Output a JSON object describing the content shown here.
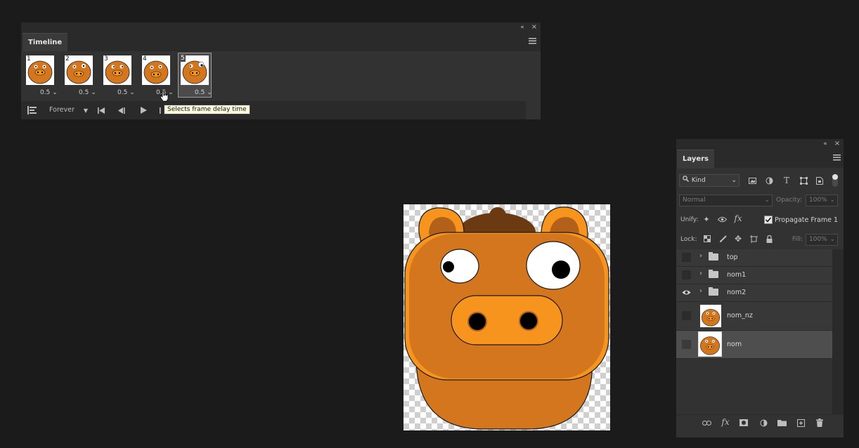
{
  "timeline": {
    "tab": "Timeline",
    "frames": [
      {
        "number": "1",
        "delay": "0.5"
      },
      {
        "number": "2",
        "delay": "0.5"
      },
      {
        "number": "3",
        "delay": "0.5"
      },
      {
        "number": "4",
        "delay": "0.5"
      },
      {
        "number": "5",
        "delay": "0.5"
      }
    ],
    "loop": "Forever",
    "tooltip": "Selects frame delay time"
  },
  "layers": {
    "tab": "Layers",
    "filter_kind": "Kind",
    "blend_mode": "Normal",
    "opacity_label": "Opacity:",
    "opacity_value": "100%",
    "unify_label": "Unify:",
    "propagate_label": "Propagate Frame 1",
    "lock_label": "Lock:",
    "fill_label": "Fill:",
    "fill_value": "100%",
    "items": [
      {
        "name": "top"
      },
      {
        "name": "nom1"
      },
      {
        "name": "nom2"
      },
      {
        "name": "nom_nz"
      },
      {
        "name": "nom"
      }
    ]
  },
  "colors": {
    "face": "#d4761e",
    "face_dark": "#b2601a",
    "snout": "#f7941d",
    "hair": "#6b3a12",
    "panel": "#323232"
  }
}
